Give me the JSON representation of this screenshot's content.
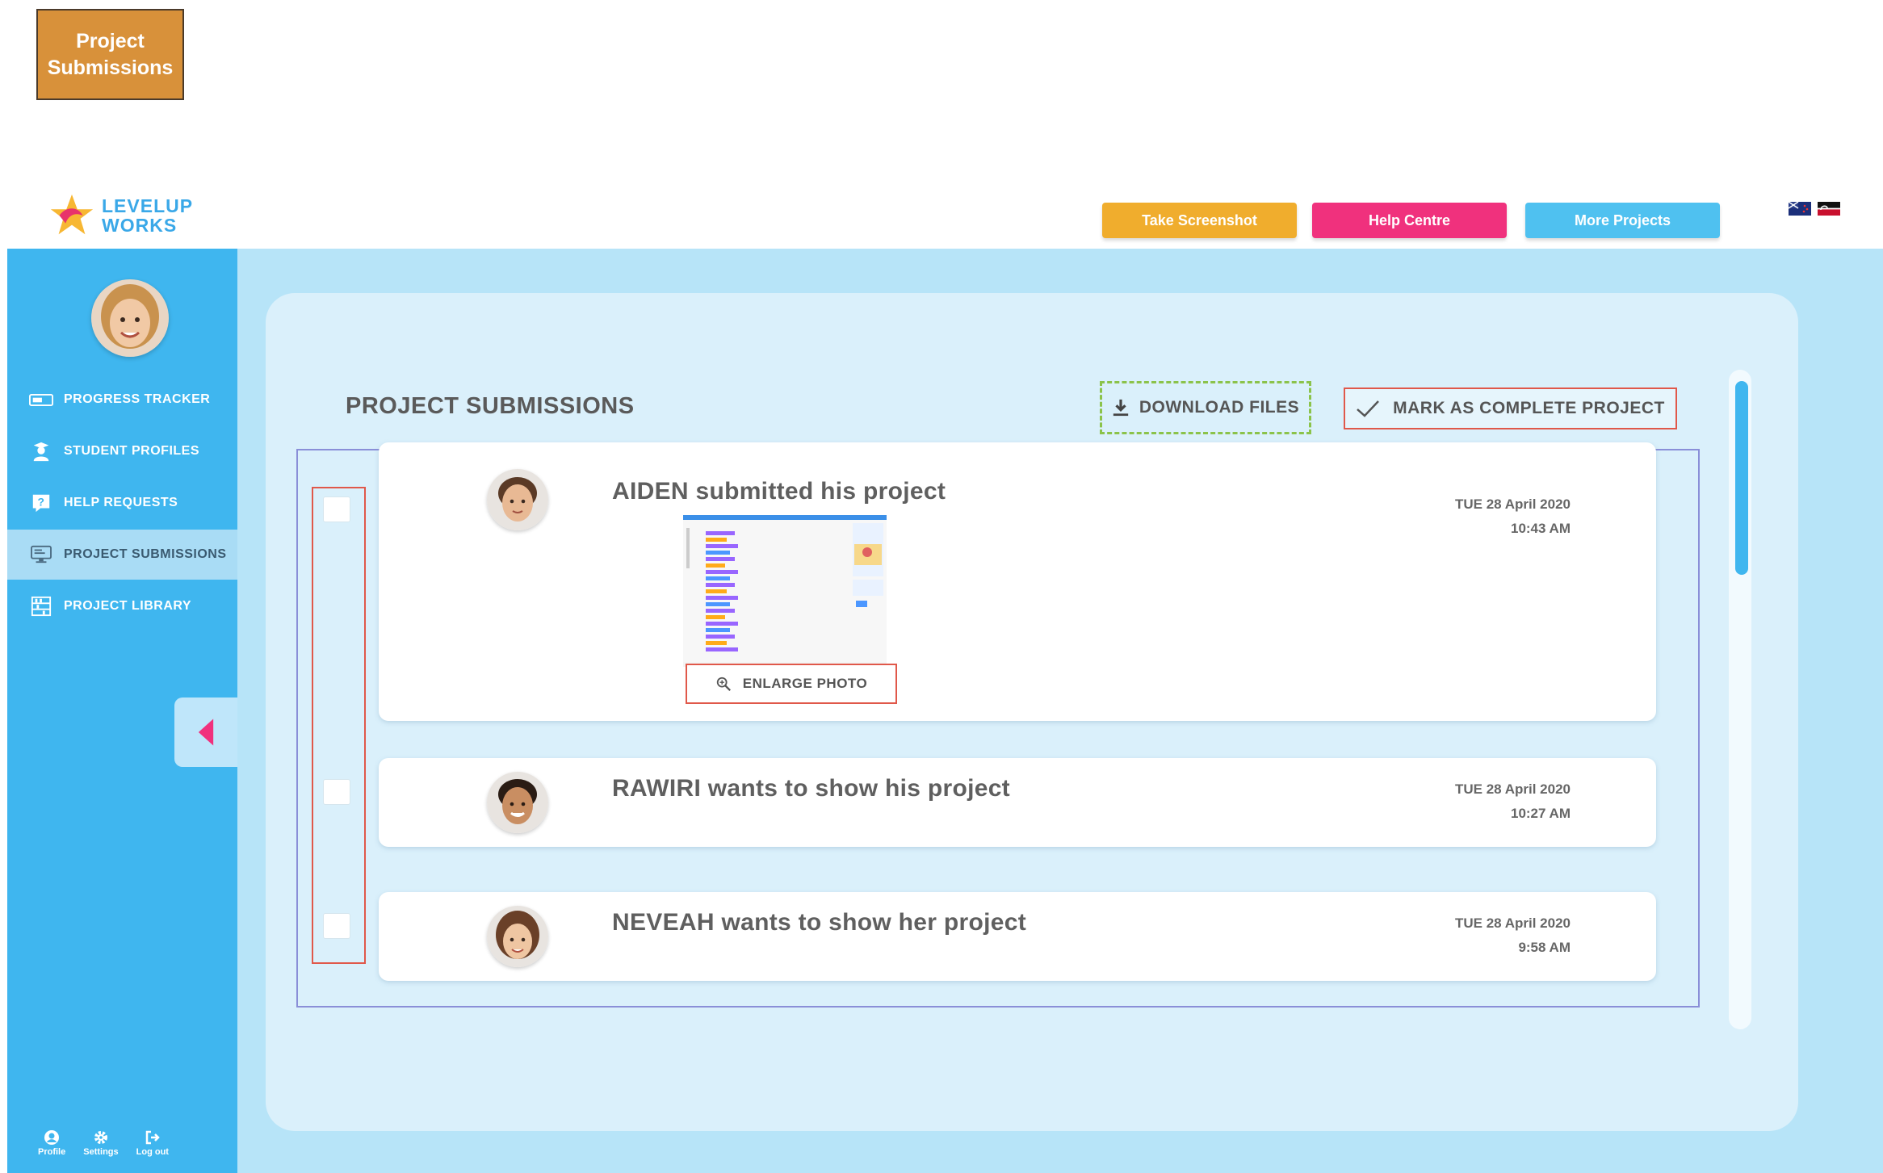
{
  "annotation": {
    "label": "Project Submissions"
  },
  "header": {
    "logo_text_line1": "LEVELUP",
    "logo_text_line2": "WORKS",
    "buttons": [
      {
        "label": "Take Screenshot",
        "color": "#f0ad2d"
      },
      {
        "label": "Help Centre",
        "color": "#f0317d"
      },
      {
        "label": "More Projects",
        "color": "#4fc1f0"
      }
    ],
    "flags": [
      "new-zealand-flag",
      "maori-flag"
    ]
  },
  "sidebar": {
    "items": [
      {
        "label": "PROGRESS TRACKER",
        "icon": "progress-bar-icon",
        "active": false
      },
      {
        "label": "STUDENT PROFILES",
        "icon": "student-icon",
        "active": false
      },
      {
        "label": "HELP REQUESTS",
        "icon": "question-icon",
        "active": false
      },
      {
        "label": "PROJECT SUBMISSIONS",
        "icon": "monitor-icon",
        "active": true
      },
      {
        "label": "PROJECT LIBRARY",
        "icon": "library-icon",
        "active": false
      }
    ],
    "bottom": [
      {
        "label": "Profile",
        "icon": "user-icon"
      },
      {
        "label": "Settings",
        "icon": "gear-icon"
      },
      {
        "label": "Log out",
        "icon": "logout-icon"
      }
    ]
  },
  "main": {
    "title": "PROJECT SUBMISSIONS",
    "download_label": "DOWNLOAD FILES",
    "complete_label": "MARK AS COMPLETE PROJECT",
    "enlarge_label": "ENLARGE PHOTO",
    "submissions": [
      {
        "student": "AIDEN",
        "title": "AIDEN submitted his project",
        "day": "TUE  28 April 2020",
        "time": "10:43 AM",
        "has_thumbnail": true
      },
      {
        "student": "RAWIRI",
        "title": "RAWIRI wants to show his project",
        "day": "TUE  28 April 2020",
        "time": "10:27 AM",
        "has_thumbnail": false
      },
      {
        "student": "NEVEAH",
        "title": "NEVEAH wants to show her project",
        "day": "TUE  28 April 2020",
        "time": "9:58 AM",
        "has_thumbnail": false
      }
    ]
  },
  "colors": {
    "sidebar": "#3fb6ef",
    "background": "#b7e4f8",
    "panel": "#daf0fb",
    "accent_pink": "#f0317d",
    "annotation_red": "#e0584a"
  }
}
